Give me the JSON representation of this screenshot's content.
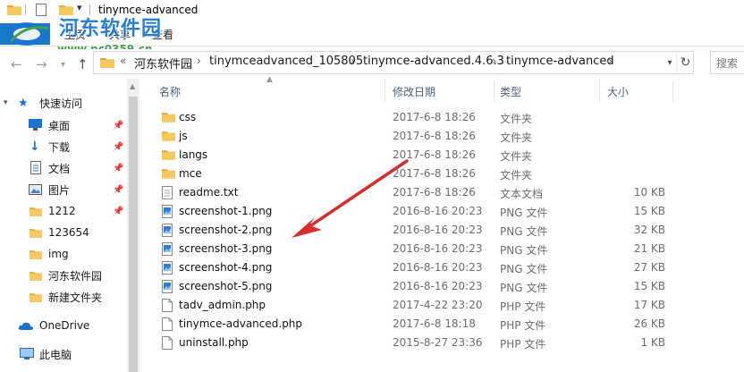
{
  "window": {
    "title": "tinymce-advanced"
  },
  "quick_access": {
    "dropdown_glyph": "▾"
  },
  "ribbon": {
    "file_tab": "文件",
    "tabs": [
      "主页",
      "共享",
      "查看"
    ]
  },
  "watermark": {
    "site_name": "河东软件园",
    "url": "www.pc0359.cn"
  },
  "address_bar": {
    "prefix": "«",
    "breadcrumbs": [
      "河东软件园",
      "tinymceadvanced_105805",
      "tinymce-advanced.4.6.3",
      "tinymce-advanced"
    ],
    "separator": "›",
    "search_placeholder": "搜索"
  },
  "sidebar": {
    "items": [
      {
        "label": "快速访问",
        "icon": "star-icon",
        "pinned": false
      },
      {
        "label": "桌面",
        "icon": "desktop-icon",
        "pinned": true
      },
      {
        "label": "下载",
        "icon": "download-icon",
        "pinned": true
      },
      {
        "label": "文档",
        "icon": "document-icon",
        "pinned": true
      },
      {
        "label": "图片",
        "icon": "picture-icon",
        "pinned": true
      },
      {
        "label": "1212",
        "icon": "folder-icon",
        "pinned": true
      },
      {
        "label": "123654",
        "icon": "folder-icon",
        "pinned": false
      },
      {
        "label": "img",
        "icon": "folder-icon",
        "pinned": false
      },
      {
        "label": "河东软件园",
        "icon": "folder-icon",
        "pinned": false
      },
      {
        "label": "新建文件夹",
        "icon": "folder-icon",
        "pinned": false
      },
      {
        "label": "OneDrive",
        "icon": "cloud-icon",
        "pinned": false
      },
      {
        "label": "此电脑",
        "icon": "computer-icon",
        "pinned": false
      }
    ]
  },
  "columns": {
    "name": "名称",
    "date": "修改日期",
    "type": "类型",
    "size": "大小"
  },
  "files": [
    {
      "name": "css",
      "date": "2017-6-8 18:26",
      "type": "文件夹",
      "size": "",
      "icon": "folder-icon"
    },
    {
      "name": "js",
      "date": "2017-6-8 18:26",
      "type": "文件夹",
      "size": "",
      "icon": "folder-icon"
    },
    {
      "name": "langs",
      "date": "2017-6-8 18:26",
      "type": "文件夹",
      "size": "",
      "icon": "folder-icon"
    },
    {
      "name": "mce",
      "date": "2017-6-8 18:26",
      "type": "文件夹",
      "size": "",
      "icon": "folder-icon"
    },
    {
      "name": "readme.txt",
      "date": "2017-6-8 18:26",
      "type": "文本文档",
      "size": "10 KB",
      "icon": "text-file-icon"
    },
    {
      "name": "screenshot-1.png",
      "date": "2016-8-16 20:23",
      "type": "PNG 文件",
      "size": "15 KB",
      "icon": "image-file-icon"
    },
    {
      "name": "screenshot-2.png",
      "date": "2016-8-16 20:23",
      "type": "PNG 文件",
      "size": "32 KB",
      "icon": "image-file-icon"
    },
    {
      "name": "screenshot-3.png",
      "date": "2016-8-16 20:23",
      "type": "PNG 文件",
      "size": "21 KB",
      "icon": "image-file-icon"
    },
    {
      "name": "screenshot-4.png",
      "date": "2016-8-16 20:23",
      "type": "PNG 文件",
      "size": "27 KB",
      "icon": "image-file-icon"
    },
    {
      "name": "screenshot-5.png",
      "date": "2016-8-16 20:23",
      "type": "PNG 文件",
      "size": "15 KB",
      "icon": "image-file-icon"
    },
    {
      "name": "tadv_admin.php",
      "date": "2017-4-22 23:20",
      "type": "PHP 文件",
      "size": "17 KB",
      "icon": "php-file-icon"
    },
    {
      "name": "tinymce-advanced.php",
      "date": "2017-6-8 18:18",
      "type": "PHP 文件",
      "size": "26 KB",
      "icon": "php-file-icon"
    },
    {
      "name": "uninstall.php",
      "date": "2015-8-27 23:36",
      "type": "PHP 文件",
      "size": "1 KB",
      "icon": "php-file-icon"
    }
  ],
  "colors": {
    "accent": "#1979ca",
    "folder": "#f6c85f",
    "folder_dark": "#e0a830",
    "annotation_arrow": "#d62d2d",
    "watermark_title": "#1a73d0",
    "watermark_url": "#43a047"
  }
}
